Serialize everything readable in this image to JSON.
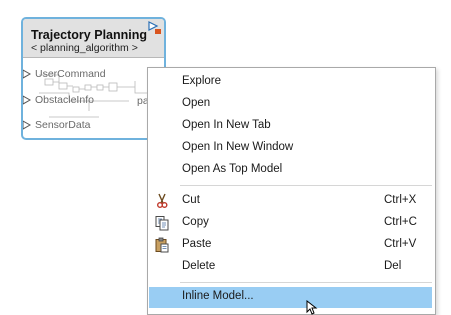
{
  "block": {
    "title": "Trajectory Planning",
    "subtitle": "< planning_algorithm >",
    "ports": [
      {
        "label": "UserCommand"
      },
      {
        "label": "ObstacleInfo"
      },
      {
        "label": "SensorData"
      }
    ],
    "preview_cut_text": "pa",
    "colors": {
      "border": "#6fb2dd",
      "header": "#e1e1e1",
      "port_marker": "#d9541e"
    }
  },
  "context_menu": {
    "groups": [
      [
        {
          "label": "Explore"
        },
        {
          "label": "Open"
        },
        {
          "label": "Open In New Tab"
        },
        {
          "label": "Open In New Window"
        },
        {
          "label": "Open As Top Model"
        }
      ],
      [
        {
          "label": "Cut",
          "shortcut": "Ctrl+X",
          "icon": "scissors-icon"
        },
        {
          "label": "Copy",
          "shortcut": "Ctrl+C",
          "icon": "copy-icon"
        },
        {
          "label": "Paste",
          "shortcut": "Ctrl+V",
          "icon": "clipboard-icon"
        },
        {
          "label": "Delete",
          "shortcut": "Del"
        }
      ],
      [
        {
          "label": "Inline Model...",
          "highlighted": true
        }
      ]
    ],
    "colors": {
      "highlight": "#99cdf3"
    }
  }
}
